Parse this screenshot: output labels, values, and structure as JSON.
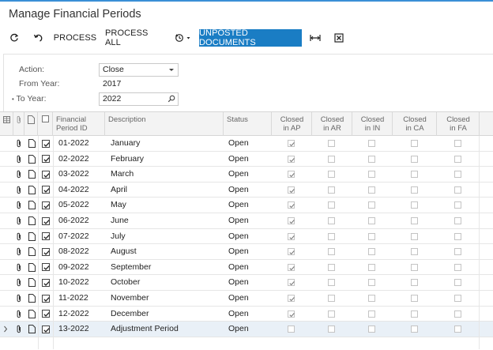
{
  "title": "Manage Financial Periods",
  "colors": {
    "accent": "#1a7dc4",
    "top_line": "#3a8fd6"
  },
  "toolbar": {
    "refresh_icon": "refresh-icon",
    "undo_icon": "undo-icon",
    "process_label": "PROCESS",
    "process_all_label": "PROCESS ALL",
    "schedule_icon": "clock-icon",
    "unposted_label": "UNPOSTED DOCUMENTS",
    "fit_icon": "fit-columns-icon",
    "excel_icon": "excel-icon"
  },
  "form": {
    "action_label": "Action:",
    "action_value": "Close",
    "from_year_label": "From Year:",
    "from_year_value": "2017",
    "to_year_label": "To Year:",
    "to_year_marker": "•",
    "to_year_value": "2022"
  },
  "grid": {
    "headers": {
      "period_id": [
        "Financial",
        "Period ID"
      ],
      "description": "Description",
      "status": "Status",
      "closed_ap": [
        "Closed",
        "in AP"
      ],
      "closed_ar": [
        "Closed",
        "in AR"
      ],
      "closed_in": [
        "Closed",
        "in IN"
      ],
      "closed_ca": [
        "Closed",
        "in CA"
      ],
      "closed_fa": [
        "Closed",
        "in FA"
      ]
    },
    "rows": [
      {
        "id": "01-2022",
        "desc": "January",
        "status": "Open",
        "ap": true,
        "ar": false,
        "in": false,
        "ca": false,
        "fa": false,
        "selected": true
      },
      {
        "id": "02-2022",
        "desc": "February",
        "status": "Open",
        "ap": true,
        "ar": false,
        "in": false,
        "ca": false,
        "fa": false,
        "selected": true
      },
      {
        "id": "03-2022",
        "desc": "March",
        "status": "Open",
        "ap": true,
        "ar": false,
        "in": false,
        "ca": false,
        "fa": false,
        "selected": true
      },
      {
        "id": "04-2022",
        "desc": "April",
        "status": "Open",
        "ap": true,
        "ar": false,
        "in": false,
        "ca": false,
        "fa": false,
        "selected": true
      },
      {
        "id": "05-2022",
        "desc": "May",
        "status": "Open",
        "ap": true,
        "ar": false,
        "in": false,
        "ca": false,
        "fa": false,
        "selected": true
      },
      {
        "id": "06-2022",
        "desc": "June",
        "status": "Open",
        "ap": true,
        "ar": false,
        "in": false,
        "ca": false,
        "fa": false,
        "selected": true
      },
      {
        "id": "07-2022",
        "desc": "July",
        "status": "Open",
        "ap": true,
        "ar": false,
        "in": false,
        "ca": false,
        "fa": false,
        "selected": true
      },
      {
        "id": "08-2022",
        "desc": "August",
        "status": "Open",
        "ap": true,
        "ar": false,
        "in": false,
        "ca": false,
        "fa": false,
        "selected": true
      },
      {
        "id": "09-2022",
        "desc": "September",
        "status": "Open",
        "ap": true,
        "ar": false,
        "in": false,
        "ca": false,
        "fa": false,
        "selected": true
      },
      {
        "id": "10-2022",
        "desc": "October",
        "status": "Open",
        "ap": true,
        "ar": false,
        "in": false,
        "ca": false,
        "fa": false,
        "selected": true
      },
      {
        "id": "11-2022",
        "desc": "November",
        "status": "Open",
        "ap": true,
        "ar": false,
        "in": false,
        "ca": false,
        "fa": false,
        "selected": true
      },
      {
        "id": "12-2022",
        "desc": "December",
        "status": "Open",
        "ap": true,
        "ar": false,
        "in": false,
        "ca": false,
        "fa": false,
        "selected": true
      },
      {
        "id": "13-2022",
        "desc": "Adjustment Period",
        "status": "Open",
        "ap": false,
        "ar": false,
        "in": false,
        "ca": false,
        "fa": false,
        "selected": true,
        "current": true
      }
    ]
  }
}
